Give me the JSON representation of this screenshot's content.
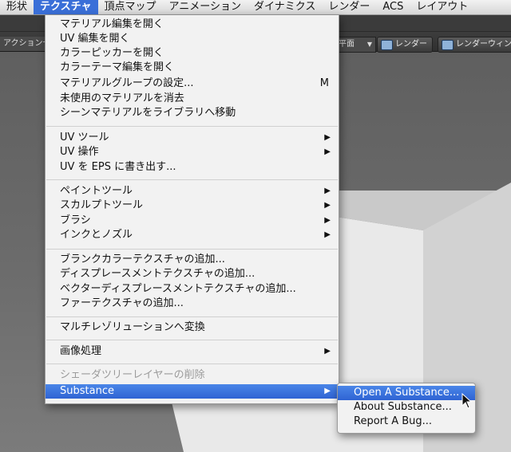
{
  "menubar": {
    "items": [
      "形状",
      "テクスチャ",
      "頂点マップ",
      "アニメーション",
      "ダイナミクス",
      "レンダー",
      "ACS",
      "レイアウト"
    ],
    "active_index": 1
  },
  "toolbar": {
    "left_label": "アクションセ",
    "dropdown_label": "平面",
    "render_button": "レンダー",
    "render_window_button": "レンダーウィン"
  },
  "menu": {
    "group1": [
      {
        "label": "マテリアル編集を開く"
      },
      {
        "label": "UV 編集を開く"
      },
      {
        "label": "カラーピッカーを開く"
      },
      {
        "label": "カラーテーマ編集を開く"
      },
      {
        "label": "マテリアルグループの設定...",
        "shortcut": "M"
      },
      {
        "label": "未使用のマテリアルを消去"
      },
      {
        "label": "シーンマテリアルをライブラリへ移動"
      }
    ],
    "group2": [
      {
        "label": "UV ツール"
      },
      {
        "label": "UV 操作"
      },
      {
        "label": "UV を EPS に書き出す..."
      }
    ],
    "group3": [
      {
        "label": "ペイントツール"
      },
      {
        "label": "スカルプトツール"
      },
      {
        "label": "ブラシ"
      },
      {
        "label": "インクとノズル"
      }
    ],
    "group4": [
      {
        "label": "ブランクカラーテクスチャの追加..."
      },
      {
        "label": "ディスプレースメントテクスチャの追加..."
      },
      {
        "label": "ベクターディスプレースメントテクスチャの追加..."
      },
      {
        "label": "ファーテクスチャの追加..."
      }
    ],
    "group5": [
      {
        "label": "マルチレゾリューションへ変換"
      }
    ],
    "group6": [
      {
        "label": "画像処理"
      }
    ],
    "group7": [
      {
        "label": "シェーダツリーレイヤーの削除"
      },
      {
        "label": "Substance"
      }
    ],
    "submenu_arrow": "▶"
  },
  "submenu": {
    "items": [
      "Open A Substance...",
      "About Substance...",
      "Report A Bug..."
    ]
  },
  "colors": {
    "highlight": "#3a6fd8",
    "menu_bg": "#f2f2f2",
    "disabled_text": "#9b9b9b"
  }
}
